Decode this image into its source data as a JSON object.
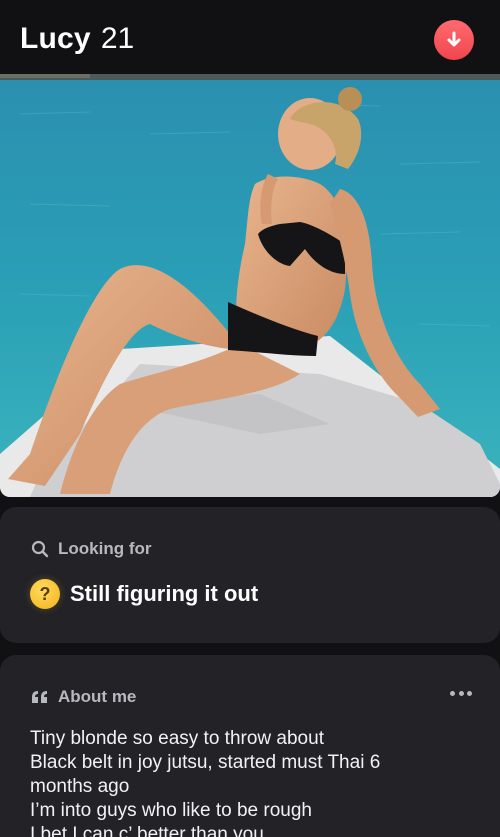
{
  "profile": {
    "name": "Lucy",
    "age": "21"
  },
  "header": {
    "collapse_icon": "arrow-down-icon",
    "accent": "#f0454f"
  },
  "photo": {
    "description_icon": "profile-photo"
  },
  "looking_for": {
    "heading": "Looking for",
    "icon": "search-icon",
    "emoji": "thinking-face",
    "value": "Still figuring it out"
  },
  "about": {
    "heading": "About me",
    "icon": "quote-icon",
    "more_icon": "more-dots-icon",
    "lines": [
      "Tiny blonde so easy to throw about",
      "Black belt in joy jutsu, started must Thai 6",
      "months ago",
      "I’m into guys who like to be rough",
      "I bet I can c’   better than you"
    ]
  }
}
